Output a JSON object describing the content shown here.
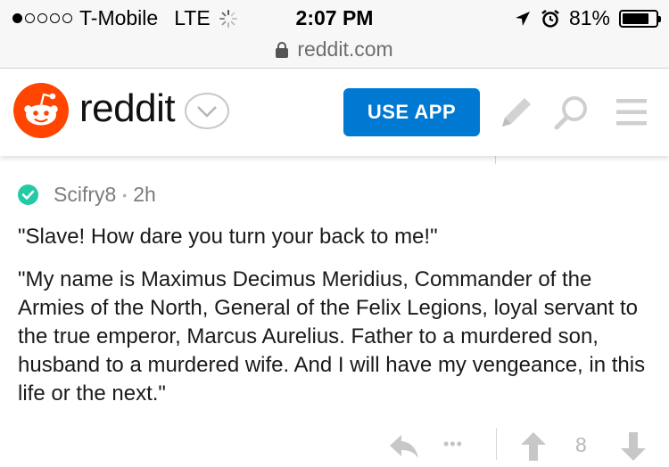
{
  "status_bar": {
    "carrier": "T-Mobile",
    "network": "LTE",
    "time": "2:07 PM",
    "battery_text": "81%",
    "battery_level": 0.81,
    "signal_dots_filled": 1,
    "signal_dots_total": 5
  },
  "browser": {
    "url": "reddit.com"
  },
  "header": {
    "wordmark": "reddit",
    "use_app_label": "USE APP",
    "brand_color": "#ff4500",
    "button_color": "#0079d3"
  },
  "icons": [
    "reddit-snoo-icon",
    "chevron-down-icon",
    "pencil-icon",
    "search-icon",
    "menu-icon",
    "check-badge-icon",
    "reply-icon",
    "more-icon",
    "upvote-icon",
    "downvote-icon",
    "lock-icon",
    "location-arrow-icon",
    "alarm-icon",
    "battery-icon",
    "loading-spinner-icon"
  ],
  "comment": {
    "author": "Scifry8",
    "age": "2h",
    "badge_color": "#24c9a6",
    "paragraphs": [
      "\"Slave! How dare you turn your back to me!\"",
      "\"My name is Maximus Decimus Meridius, Commander of the Armies of the North, General of the Felix Legions, loyal servant to the true emperor, Marcus Aurelius. Father to a murdered son, husband to a murdered wife. And I will have my vengeance, in this life or the next.\""
    ],
    "more_label": "•••",
    "score": "8"
  }
}
